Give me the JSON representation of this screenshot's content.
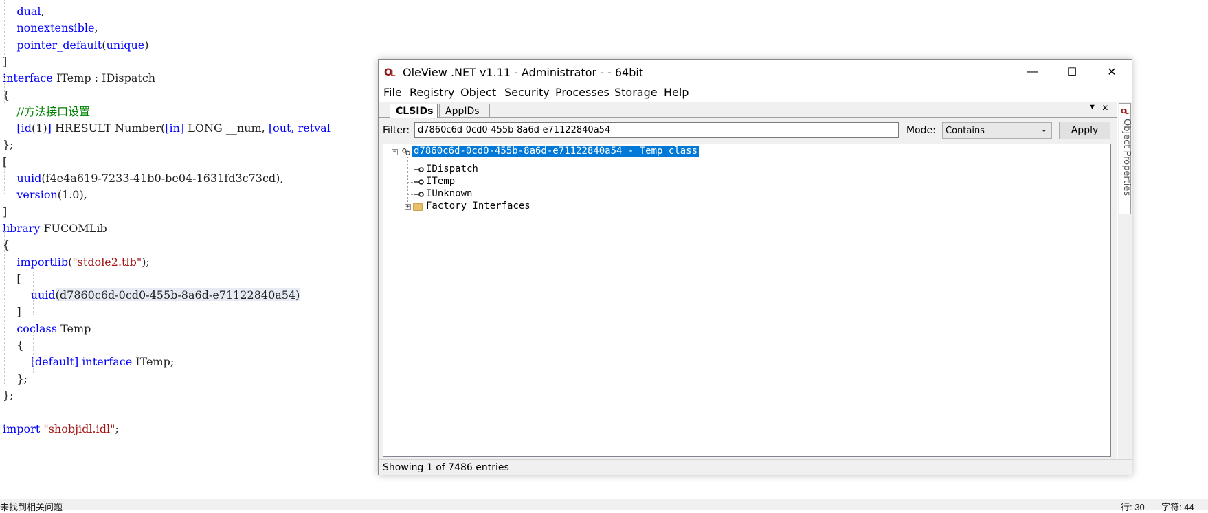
{
  "editor": {
    "lines": [
      [
        {
          "t": "    "
        },
        {
          "t": "dual",
          "c": "kw"
        },
        {
          "t": ","
        }
      ],
      [
        {
          "t": "    "
        },
        {
          "t": "nonextensible",
          "c": "kw"
        },
        {
          "t": ","
        }
      ],
      [
        {
          "t": "    "
        },
        {
          "t": "pointer_default",
          "c": "kw"
        },
        {
          "t": "("
        },
        {
          "t": "unique",
          "c": "kw"
        },
        {
          "t": ")"
        }
      ],
      [
        {
          "t": "]"
        }
      ],
      [
        {
          "t": "interface",
          "c": "kw"
        },
        {
          "t": " ITemp : IDispatch"
        }
      ],
      [
        {
          "t": "{"
        }
      ],
      [
        {
          "t": "    "
        },
        {
          "t": "//方法接口设置",
          "c": "cm"
        }
      ],
      [
        {
          "t": "    "
        },
        {
          "t": "[id",
          "c": "kw"
        },
        {
          "t": "(1)"
        },
        {
          "t": "]",
          "c": "kw"
        },
        {
          "t": " HRESULT Number("
        },
        {
          "t": "[in]",
          "c": "kw"
        },
        {
          "t": " LONG __num, "
        },
        {
          "t": "[out, retval",
          "c": "kw"
        }
      ],
      [
        {
          "t": "};"
        }
      ],
      [
        {
          "t": "["
        }
      ],
      [
        {
          "t": "    "
        },
        {
          "t": "uuid",
          "c": "kw"
        },
        {
          "t": "(f4e4a619-7233-41b0-be04-1631fd3c73cd),"
        }
      ],
      [
        {
          "t": "    "
        },
        {
          "t": "version",
          "c": "kw"
        },
        {
          "t": "(1.0),"
        }
      ],
      [
        {
          "t": "]"
        }
      ],
      [
        {
          "t": "library",
          "c": "kw"
        },
        {
          "t": " FUCOMLib"
        }
      ],
      [
        {
          "t": "{"
        }
      ],
      [
        {
          "t": "    "
        },
        {
          "t": "importlib",
          "c": "kw"
        },
        {
          "t": "("
        },
        {
          "t": "\"stdole2.tlb\"",
          "c": "str"
        },
        {
          "t": ");"
        }
      ],
      [
        {
          "t": "    ["
        }
      ],
      [
        {
          "t": "        "
        },
        {
          "t": "uuid",
          "c": "kw"
        },
        {
          "t": "(d7860c6d-0cd0-455b-8a6d-e71122840a54)",
          "c": "hl"
        }
      ],
      [
        {
          "t": "    ]"
        }
      ],
      [
        {
          "t": "    "
        },
        {
          "t": "coclass",
          "c": "kw"
        },
        {
          "t": " Temp"
        }
      ],
      [
        {
          "t": "    {"
        }
      ],
      [
        {
          "t": "        "
        },
        {
          "t": "[default]",
          "c": "kw"
        },
        {
          "t": " "
        },
        {
          "t": "interface",
          "c": "kw"
        },
        {
          "t": " ITemp;"
        }
      ],
      [
        {
          "t": "    };"
        }
      ],
      [
        {
          "t": "};"
        }
      ],
      [
        {
          "t": ""
        }
      ],
      [
        {
          "t": "import",
          "c": "kw"
        },
        {
          "t": " "
        },
        {
          "t": "\"shobjidl.idl\"",
          "c": "str"
        },
        {
          "t": ";"
        }
      ]
    ]
  },
  "editor_status": {
    "problems": "未找到相关问题",
    "line": "行: 30",
    "char": "字符: 44"
  },
  "window": {
    "title": "OleView .NET v1.11 - Administrator - - 64bit",
    "controls": {
      "minimize": "—",
      "maximize": "☐",
      "close": "✕"
    },
    "menu": [
      "File",
      "Registry",
      "Object",
      "Security",
      "Processes",
      "Storage",
      "Help"
    ],
    "tabs": {
      "clsids": "CLSIDs",
      "appids": "AppIDs"
    },
    "filter_label": "Filter:",
    "filter_value": "d7860c6d-0cd0-455b-8a6d-e71122840a54",
    "mode_label": "Mode:",
    "mode_value": "Contains",
    "apply_label": "Apply",
    "tree": {
      "root": "d7860c6d-0cd0-455b-8a6d-e71122840a54 - Temp class",
      "interfaces": [
        "IDispatch",
        "ITemp",
        "IUnknown"
      ],
      "factory": "Factory Interfaces"
    },
    "status": "Showing 1 of 7486 entries",
    "side_panel_label": "Object Properties"
  },
  "colors": {
    "keyword": "#0000ff",
    "string": "#a31515",
    "comment": "#008000",
    "selection": "#0078d7"
  }
}
